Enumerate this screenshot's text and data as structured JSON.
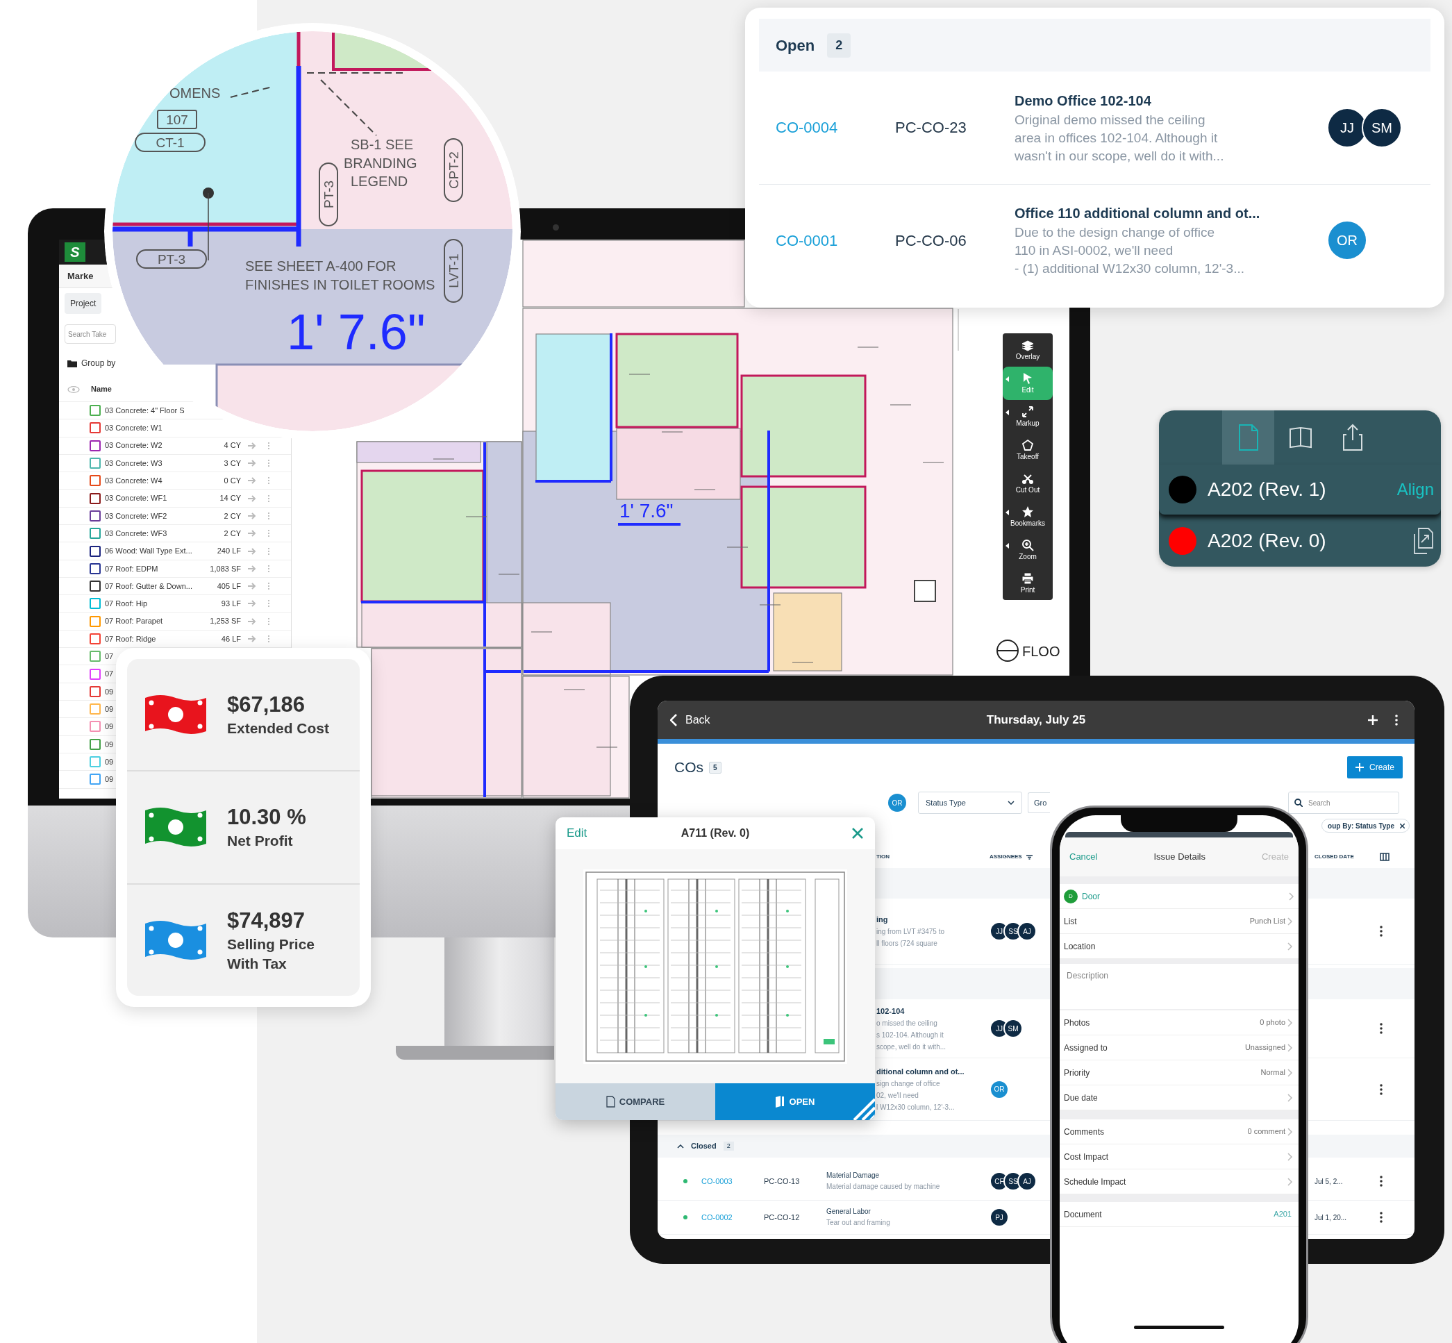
{
  "magnifier": {
    "labels": [
      {
        "text": "OMENS",
        "kind": "plain"
      },
      {
        "text": "107",
        "kind": "boxed"
      },
      {
        "text": "CT-1",
        "kind": "pill"
      },
      {
        "text": "SB-1 SEE",
        "kind": "plain"
      },
      {
        "text": "BRANDING",
        "kind": "plain"
      },
      {
        "text": "LEGEND",
        "kind": "plain"
      },
      {
        "text": "PT-3",
        "kind": "vertical"
      },
      {
        "text": "CPT-2",
        "kind": "vertical"
      },
      {
        "text": "LVT-1",
        "kind": "vertical"
      },
      {
        "text": "PT-3",
        "kind": "pill"
      },
      {
        "text": "SEE SHEET A-400 FOR",
        "kind": "plain"
      },
      {
        "text": "FINISHES IN TOILET ROOMS",
        "kind": "plain"
      },
      {
        "text": "1' 7.6\"",
        "kind": "dimension"
      }
    ]
  },
  "takeoff_app": {
    "logo": "S",
    "menu": "Marke",
    "project": "Project",
    "search": {
      "placeholder": "Search Take"
    },
    "group_by": "Group by",
    "column": "Name",
    "items": [
      {
        "name": "03 Concrete: 4\" Floor S",
        "color": "#4caf50"
      },
      {
        "name": "03 Concrete: W1",
        "color": "#e53935"
      },
      {
        "name": "03 Concrete: W2",
        "quantity": "4 CY",
        "color": "#9c27b0"
      },
      {
        "name": "03 Concrete: W3",
        "quantity": "3 CY",
        "color": "#4db6ac"
      },
      {
        "name": "03 Concrete: W4",
        "quantity": "0 CY",
        "color": "#e64a19"
      },
      {
        "name": "03 Concrete: WF1",
        "quantity": "14 CY",
        "color": "#8b1a1a"
      },
      {
        "name": "03 Concrete: WF2",
        "quantity": "2 CY",
        "color": "#6a3d9a"
      },
      {
        "name": "03 Concrete: WF3",
        "quantity": "2 CY",
        "color": "#26a69a"
      },
      {
        "name": "06 Wood: Wall Type Ext...",
        "quantity": "240 LF",
        "color": "#1a237e"
      },
      {
        "name": "07 Roof: EDPM",
        "quantity": "1,083 SF",
        "color": "#283593"
      },
      {
        "name": "07 Roof: Gutter & Down...",
        "quantity": "405 LF",
        "color": "#333333"
      },
      {
        "name": "07 Roof: Hip",
        "quantity": "93 LF",
        "color": "#00bcd4"
      },
      {
        "name": "07 Roof: Parapet",
        "quantity": "1,253 SF",
        "color": "#ff9800"
      },
      {
        "name": "07 Roof: Ridge",
        "quantity": "46 LF",
        "color": "#f44336"
      },
      {
        "name": "07",
        "color": "#66bb6a"
      },
      {
        "name": "07",
        "color": "#e040fb"
      },
      {
        "name": "09",
        "color": "#e53935"
      },
      {
        "name": "09",
        "color": "#ffb74d"
      },
      {
        "name": "09",
        "color": "#f48fb1"
      },
      {
        "name": "09",
        "color": "#43a047"
      },
      {
        "name": "09",
        "color": "#4dd0e1"
      },
      {
        "name": "09",
        "color": "#42a5f5"
      }
    ]
  },
  "plan": {
    "dimension": "1' 7.6\"",
    "floor_label": "FLOO"
  },
  "toolbar": [
    {
      "label": "Overlay",
      "kind": "layers",
      "submenu": false,
      "selected": false
    },
    {
      "label": "Edit",
      "kind": "pointer",
      "submenu": true,
      "selected": true
    },
    {
      "label": "Markup",
      "kind": "expand",
      "submenu": true,
      "selected": false
    },
    {
      "label": "Takeoff",
      "kind": "pentagon",
      "submenu": false,
      "selected": false
    },
    {
      "label": "Cut Out",
      "kind": "cutout",
      "submenu": false,
      "selected": false
    },
    {
      "label": "Bookmarks",
      "kind": "star",
      "submenu": true,
      "selected": false
    },
    {
      "label": "Zoom",
      "kind": "zoom",
      "submenu": true,
      "selected": false
    },
    {
      "label": "Print",
      "kind": "print",
      "submenu": false,
      "selected": false
    }
  ],
  "change_orders_panel": {
    "group": "Open",
    "count": "2",
    "rows": [
      {
        "id": "CO-0004",
        "reference": "PC-CO-23",
        "title": "Demo Office 102-104",
        "description": [
          "Original demo missed the ceiling",
          "area in offices 102-104. Although it",
          "wasn't in our scope, well do it with..."
        ],
        "assignees": [
          {
            "initials": "JJ",
            "color": "#0e2a44"
          },
          {
            "initials": "SM",
            "color": "#0e2a44"
          }
        ]
      },
      {
        "id": "CO-0001",
        "reference": "PC-CO-06",
        "title": "Office 110 additional column and ot...",
        "description": [
          "Due to the design change of office",
          "110 in ASI-0002, we'll need",
          "- (1) additional W12x30 column, 12'-3..."
        ],
        "assignees": [
          {
            "initials": "OR",
            "color": "#1a8fd0"
          }
        ]
      }
    ]
  },
  "sheet_panel": {
    "tabs": [
      {
        "kind": "page",
        "selected": true
      },
      {
        "kind": "book",
        "selected": false
      },
      {
        "kind": "share",
        "selected": false
      }
    ],
    "sheets": [
      {
        "name": "A202 (Rev. 1)",
        "color": "#000000",
        "action": "Align",
        "selected": true
      },
      {
        "name": "A202 (Rev. 0)",
        "color": "#ff0000",
        "selected": false
      }
    ]
  },
  "cost_summary": [
    {
      "value": "$67,186",
      "label": "Extended Cost",
      "color": "#e8141d"
    },
    {
      "value": "10.30 %",
      "label": "Net Profit",
      "color": "#12932f"
    },
    {
      "value": "$74,897",
      "label": "Selling Price With Tax",
      "color": "#1a8fe0"
    }
  ],
  "tablet": {
    "back": "Back",
    "title": "Thursday, July 25",
    "heading": "COs",
    "count": "5",
    "create": "Create",
    "filters": {
      "assignee": {
        "initials": "OR",
        "color": "#1a8fd0"
      },
      "status": "Status Type",
      "group": "Gro",
      "search": {
        "placeholder": "Search"
      },
      "chip": "oup By: Status Type"
    },
    "columns": [
      "TION",
      "ASSIGNEES",
      "CLOSED DATE"
    ],
    "open_rows": [
      {
        "title": "ing",
        "description": [
          "ing from LVT #3475 to",
          "ll floors (724 square"
        ],
        "assignees": [
          {
            "initials": "JJ",
            "color": "#0e2a44"
          },
          {
            "initials": "SS",
            "color": "#0e2a44"
          },
          {
            "initials": "AJ",
            "color": "#0e2a44"
          }
        ]
      },
      {
        "title": "102-104",
        "description": [
          "o missed the ceiling",
          "s 102-104. Although it",
          "scope, well do it with..."
        ],
        "assignees": [
          {
            "initials": "JJ",
            "color": "#0e2a44"
          },
          {
            "initials": "SM",
            "color": "#0e2a44"
          }
        ]
      },
      {
        "title": "ditional column and ot...",
        "description": [
          "sign change of office",
          "02, we'll need",
          "l W12x30 column, 12'-3..."
        ],
        "assignees": [
          {
            "initials": "OR",
            "color": "#1a8fd0"
          }
        ]
      }
    ],
    "closed_group": {
      "label": "Closed",
      "count": "2",
      "expanded": true
    },
    "closed_rows": [
      {
        "id": "CO-0003",
        "reference": "PC-CO-13",
        "title": "Material Damage",
        "description": "Material damage caused by machine",
        "assignees": [
          {
            "initials": "CF",
            "color": "#0e2a44"
          },
          {
            "initials": "SS",
            "color": "#0e2a44"
          },
          {
            "initials": "AJ",
            "color": "#0e2a44"
          }
        ],
        "closed_date": "Jul 5, 2..."
      },
      {
        "id": "CO-0002",
        "reference": "PC-CO-12",
        "title": "General Labor",
        "description": "Tear out and framing",
        "assignees": [
          {
            "initials": "PJ",
            "color": "#0e2a44"
          }
        ],
        "closed_date": "Jul 1, 20..."
      }
    ]
  },
  "sheet_popup": {
    "edit": "Edit",
    "title": "A711 (Rev. 0)",
    "compare": "COMPARE",
    "open": "OPEN"
  },
  "phone": {
    "cancel": "Cancel",
    "title": "Issue Details",
    "create": {
      "label": "Create",
      "disabled": true
    },
    "sections": [
      [
        {
          "kind": "type",
          "badge": "D",
          "label": "Door",
          "color": "#1f9d3a"
        },
        {
          "kind": "row",
          "label": "List",
          "value": "Punch List"
        },
        {
          "kind": "row",
          "label": "Location"
        }
      ],
      [
        {
          "kind": "textarea",
          "placeholder": "Description"
        }
      ],
      [
        {
          "kind": "row",
          "label": "Photos",
          "value": "0 photo"
        },
        {
          "kind": "row",
          "label": "Assigned to",
          "value": "Unassigned"
        },
        {
          "kind": "row",
          "label": "Priority",
          "value": "Normal"
        },
        {
          "kind": "row",
          "label": "Due date"
        }
      ],
      [
        {
          "kind": "row",
          "label": "Comments",
          "value": "0 comment"
        },
        {
          "kind": "row",
          "label": "Cost Impact"
        },
        {
          "kind": "row",
          "label": "Schedule Impact"
        }
      ],
      [
        {
          "kind": "link",
          "label": "Document",
          "value": "A201"
        }
      ]
    ]
  }
}
